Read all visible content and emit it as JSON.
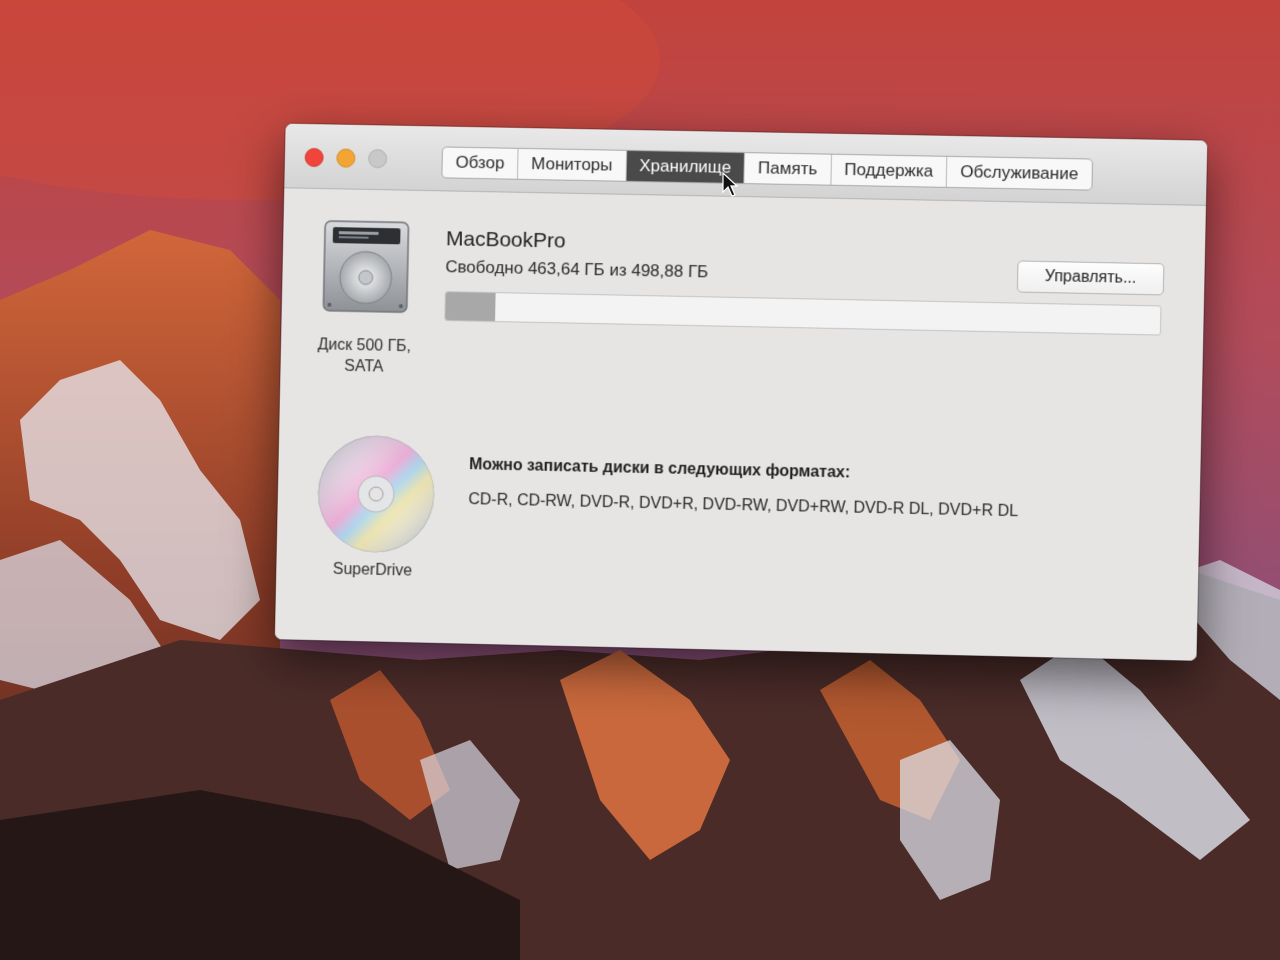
{
  "window": {
    "tabs": [
      {
        "label": "Обзор"
      },
      {
        "label": "Мониторы"
      },
      {
        "label": "Хранилище"
      },
      {
        "label": "Память"
      },
      {
        "label": "Поддержка"
      },
      {
        "label": "Обслуживание"
      }
    ],
    "active_tab": "Хранилище"
  },
  "storage": {
    "disk_name": "MacBookPro",
    "free_text": "Свободно 463,64 ГБ из 498,88 ГБ",
    "disk_caption_line1": "Диск 500 ГБ,",
    "disk_caption_line2": "SATA",
    "manage_label": "Управлять...",
    "used_fraction": 0.07
  },
  "optical": {
    "name": "SuperDrive",
    "heading": "Можно записать диски в следующих форматах:",
    "formats": "CD-R, CD-RW, DVD-R, DVD+R, DVD-RW, DVD+RW, DVD-R DL, DVD+R DL"
  },
  "colors": {
    "close": "#f0443c",
    "minimize": "#f2a533",
    "zoom_disabled": "#c9c8c8",
    "active_tab": "#4a4a4a"
  }
}
